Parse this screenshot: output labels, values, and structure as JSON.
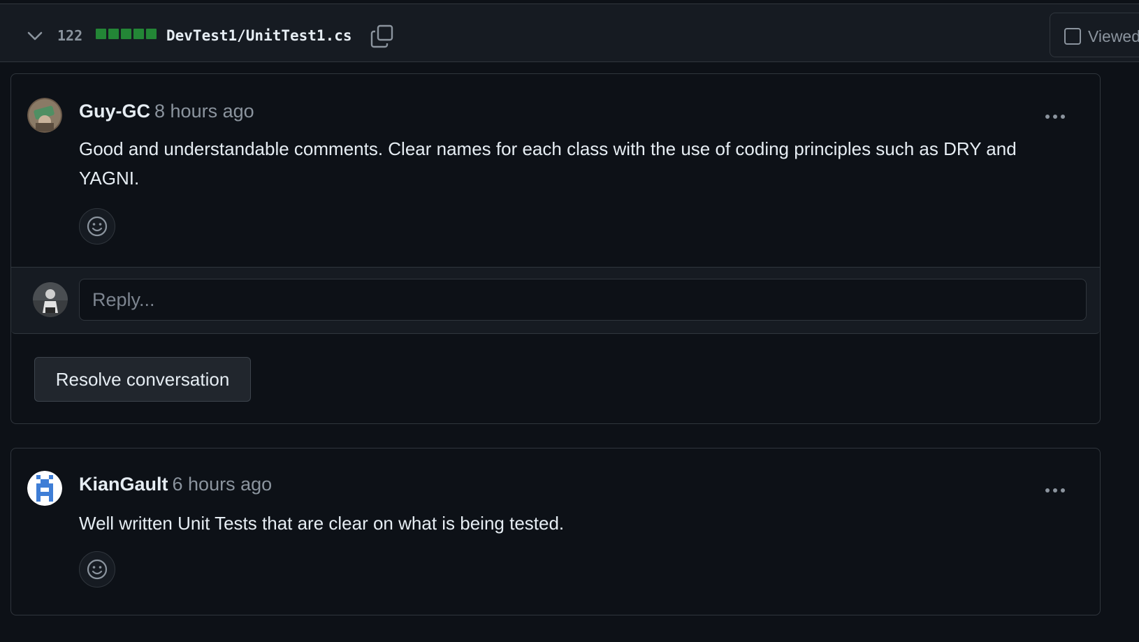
{
  "file_header": {
    "diff_count": "122",
    "diffstat_blocks": 5,
    "diffstat_color": "#238636",
    "file_path": "DevTest1/UnitTest1.cs",
    "viewed_label": "Viewed",
    "icons": [
      "chevron-down-icon",
      "copy-icon",
      "checkbox-icon"
    ]
  },
  "threads": [
    {
      "comment": {
        "author": "Guy-GC",
        "time": "8 hours ago",
        "body": "Good and understandable comments. Clear names for each class with the use of coding principles such as DRY and YAGNI."
      },
      "reply_placeholder": "Reply...",
      "resolve_label": "Resolve conversation"
    },
    {
      "comment": {
        "author": "KianGault",
        "time": "6 hours ago",
        "body": "Well written Unit Tests that are clear on what is being tested."
      }
    }
  ],
  "colors": {
    "background": "#0d1117",
    "panel": "#161b22",
    "border": "#30363d",
    "muted_text": "#8b949e",
    "text": "#e6edf3"
  }
}
